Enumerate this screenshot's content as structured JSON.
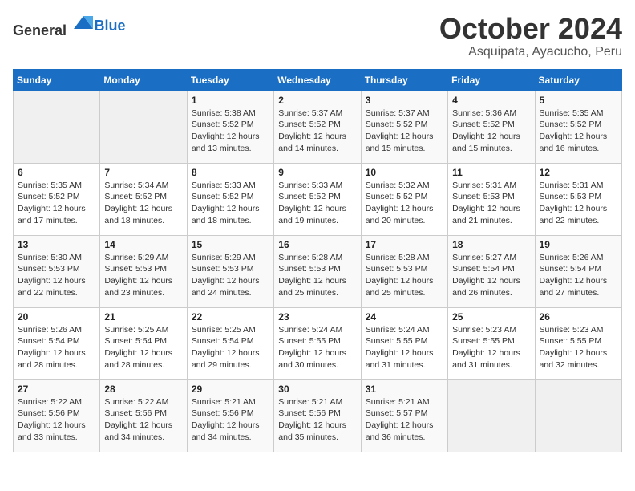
{
  "header": {
    "logo_general": "General",
    "logo_blue": "Blue",
    "month_title": "October 2024",
    "location": "Asquipata, Ayacucho, Peru"
  },
  "weekdays": [
    "Sunday",
    "Monday",
    "Tuesday",
    "Wednesday",
    "Thursday",
    "Friday",
    "Saturday"
  ],
  "weeks": [
    [
      {
        "day": "",
        "info": ""
      },
      {
        "day": "",
        "info": ""
      },
      {
        "day": "1",
        "sunrise": "Sunrise: 5:38 AM",
        "sunset": "Sunset: 5:52 PM",
        "daylight": "Daylight: 12 hours and 13 minutes."
      },
      {
        "day": "2",
        "sunrise": "Sunrise: 5:37 AM",
        "sunset": "Sunset: 5:52 PM",
        "daylight": "Daylight: 12 hours and 14 minutes."
      },
      {
        "day": "3",
        "sunrise": "Sunrise: 5:37 AM",
        "sunset": "Sunset: 5:52 PM",
        "daylight": "Daylight: 12 hours and 15 minutes."
      },
      {
        "day": "4",
        "sunrise": "Sunrise: 5:36 AM",
        "sunset": "Sunset: 5:52 PM",
        "daylight": "Daylight: 12 hours and 15 minutes."
      },
      {
        "day": "5",
        "sunrise": "Sunrise: 5:35 AM",
        "sunset": "Sunset: 5:52 PM",
        "daylight": "Daylight: 12 hours and 16 minutes."
      }
    ],
    [
      {
        "day": "6",
        "sunrise": "Sunrise: 5:35 AM",
        "sunset": "Sunset: 5:52 PM",
        "daylight": "Daylight: 12 hours and 17 minutes."
      },
      {
        "day": "7",
        "sunrise": "Sunrise: 5:34 AM",
        "sunset": "Sunset: 5:52 PM",
        "daylight": "Daylight: 12 hours and 18 minutes."
      },
      {
        "day": "8",
        "sunrise": "Sunrise: 5:33 AM",
        "sunset": "Sunset: 5:52 PM",
        "daylight": "Daylight: 12 hours and 18 minutes."
      },
      {
        "day": "9",
        "sunrise": "Sunrise: 5:33 AM",
        "sunset": "Sunset: 5:52 PM",
        "daylight": "Daylight: 12 hours and 19 minutes."
      },
      {
        "day": "10",
        "sunrise": "Sunrise: 5:32 AM",
        "sunset": "Sunset: 5:52 PM",
        "daylight": "Daylight: 12 hours and 20 minutes."
      },
      {
        "day": "11",
        "sunrise": "Sunrise: 5:31 AM",
        "sunset": "Sunset: 5:53 PM",
        "daylight": "Daylight: 12 hours and 21 minutes."
      },
      {
        "day": "12",
        "sunrise": "Sunrise: 5:31 AM",
        "sunset": "Sunset: 5:53 PM",
        "daylight": "Daylight: 12 hours and 22 minutes."
      }
    ],
    [
      {
        "day": "13",
        "sunrise": "Sunrise: 5:30 AM",
        "sunset": "Sunset: 5:53 PM",
        "daylight": "Daylight: 12 hours and 22 minutes."
      },
      {
        "day": "14",
        "sunrise": "Sunrise: 5:29 AM",
        "sunset": "Sunset: 5:53 PM",
        "daylight": "Daylight: 12 hours and 23 minutes."
      },
      {
        "day": "15",
        "sunrise": "Sunrise: 5:29 AM",
        "sunset": "Sunset: 5:53 PM",
        "daylight": "Daylight: 12 hours and 24 minutes."
      },
      {
        "day": "16",
        "sunrise": "Sunrise: 5:28 AM",
        "sunset": "Sunset: 5:53 PM",
        "daylight": "Daylight: 12 hours and 25 minutes."
      },
      {
        "day": "17",
        "sunrise": "Sunrise: 5:28 AM",
        "sunset": "Sunset: 5:53 PM",
        "daylight": "Daylight: 12 hours and 25 minutes."
      },
      {
        "day": "18",
        "sunrise": "Sunrise: 5:27 AM",
        "sunset": "Sunset: 5:54 PM",
        "daylight": "Daylight: 12 hours and 26 minutes."
      },
      {
        "day": "19",
        "sunrise": "Sunrise: 5:26 AM",
        "sunset": "Sunset: 5:54 PM",
        "daylight": "Daylight: 12 hours and 27 minutes."
      }
    ],
    [
      {
        "day": "20",
        "sunrise": "Sunrise: 5:26 AM",
        "sunset": "Sunset: 5:54 PM",
        "daylight": "Daylight: 12 hours and 28 minutes."
      },
      {
        "day": "21",
        "sunrise": "Sunrise: 5:25 AM",
        "sunset": "Sunset: 5:54 PM",
        "daylight": "Daylight: 12 hours and 28 minutes."
      },
      {
        "day": "22",
        "sunrise": "Sunrise: 5:25 AM",
        "sunset": "Sunset: 5:54 PM",
        "daylight": "Daylight: 12 hours and 29 minutes."
      },
      {
        "day": "23",
        "sunrise": "Sunrise: 5:24 AM",
        "sunset": "Sunset: 5:55 PM",
        "daylight": "Daylight: 12 hours and 30 minutes."
      },
      {
        "day": "24",
        "sunrise": "Sunrise: 5:24 AM",
        "sunset": "Sunset: 5:55 PM",
        "daylight": "Daylight: 12 hours and 31 minutes."
      },
      {
        "day": "25",
        "sunrise": "Sunrise: 5:23 AM",
        "sunset": "Sunset: 5:55 PM",
        "daylight": "Daylight: 12 hours and 31 minutes."
      },
      {
        "day": "26",
        "sunrise": "Sunrise: 5:23 AM",
        "sunset": "Sunset: 5:55 PM",
        "daylight": "Daylight: 12 hours and 32 minutes."
      }
    ],
    [
      {
        "day": "27",
        "sunrise": "Sunrise: 5:22 AM",
        "sunset": "Sunset: 5:56 PM",
        "daylight": "Daylight: 12 hours and 33 minutes."
      },
      {
        "day": "28",
        "sunrise": "Sunrise: 5:22 AM",
        "sunset": "Sunset: 5:56 PM",
        "daylight": "Daylight: 12 hours and 34 minutes."
      },
      {
        "day": "29",
        "sunrise": "Sunrise: 5:21 AM",
        "sunset": "Sunset: 5:56 PM",
        "daylight": "Daylight: 12 hours and 34 minutes."
      },
      {
        "day": "30",
        "sunrise": "Sunrise: 5:21 AM",
        "sunset": "Sunset: 5:56 PM",
        "daylight": "Daylight: 12 hours and 35 minutes."
      },
      {
        "day": "31",
        "sunrise": "Sunrise: 5:21 AM",
        "sunset": "Sunset: 5:57 PM",
        "daylight": "Daylight: 12 hours and 36 minutes."
      },
      {
        "day": "",
        "info": ""
      },
      {
        "day": "",
        "info": ""
      }
    ]
  ]
}
